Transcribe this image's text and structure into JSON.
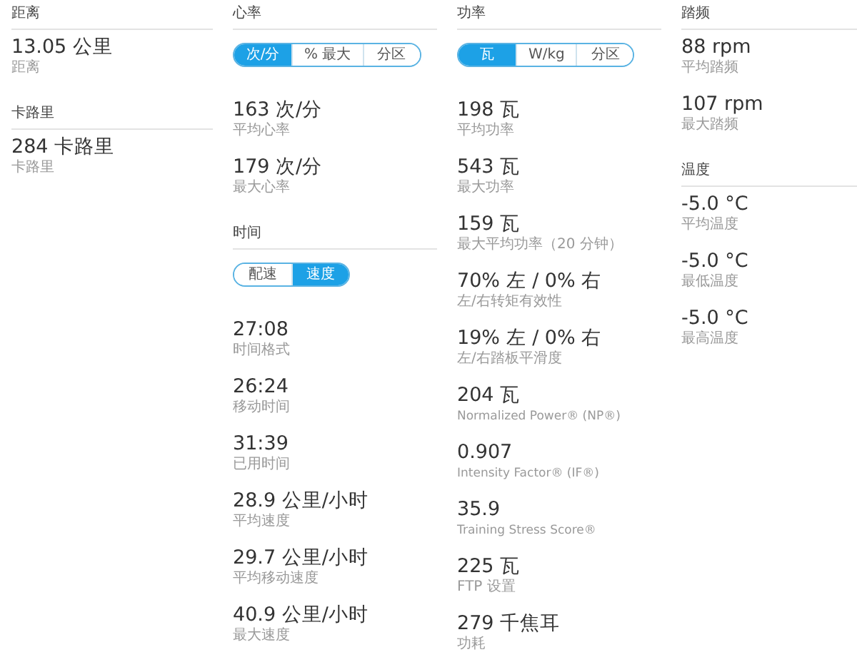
{
  "columns": [
    {
      "sections": [
        {
          "title": "距离",
          "stats": [
            {
              "value": "13.05 公里",
              "label": "距离"
            }
          ]
        },
        {
          "title": "卡路里",
          "stats": [
            {
              "value": "284 卡路里",
              "label": "卡路里"
            }
          ]
        }
      ]
    },
    {
      "sections": [
        {
          "title": "心率",
          "toggle": [
            {
              "label": "次/分",
              "selected": true
            },
            {
              "label": "% 最大",
              "selected": false
            },
            {
              "label": "分区",
              "selected": false
            }
          ],
          "stats": [
            {
              "value": "163 次/分",
              "label": "平均心率"
            },
            {
              "value": "179 次/分",
              "label": "最大心率"
            }
          ]
        },
        {
          "title": "时间",
          "toggle": [
            {
              "label": "配速",
              "selected": false
            },
            {
              "label": "速度",
              "selected": true
            }
          ],
          "stats": [
            {
              "value": "27:08",
              "label": "时间格式"
            },
            {
              "value": "26:24",
              "label": "移动时间"
            },
            {
              "value": "31:39",
              "label": "已用时间"
            },
            {
              "value": "28.9 公里/小时",
              "label": "平均速度"
            },
            {
              "value": "29.7 公里/小时",
              "label": "平均移动速度"
            },
            {
              "value": "40.9 公里/小时",
              "label": "最大速度"
            }
          ]
        }
      ]
    },
    {
      "sections": [
        {
          "title": "功率",
          "toggle": [
            {
              "label": "瓦",
              "selected": true
            },
            {
              "label": "W/kg",
              "selected": false
            },
            {
              "label": "分区",
              "selected": false
            }
          ],
          "stats": [
            {
              "value": "198 瓦",
              "label": "平均功率"
            },
            {
              "value": "543 瓦",
              "label": "最大功率"
            },
            {
              "value": "159 瓦",
              "label": "最大平均功率（20 分钟）"
            },
            {
              "value": "70% 左 / 0% 右",
              "label": "左/右转矩有效性"
            },
            {
              "value": "19% 左 / 0% 右",
              "label": "左/右踏板平滑度"
            },
            {
              "value": "204 瓦",
              "label": "Normalized Power® (NP®)"
            },
            {
              "value": "0.907",
              "label": "Intensity Factor® (IF®)"
            },
            {
              "value": "35.9",
              "label": "Training Stress Score®"
            },
            {
              "value": "225 瓦",
              "label": "FTP 设置"
            },
            {
              "value": "279 千焦耳",
              "label": "功耗"
            }
          ]
        }
      ]
    },
    {
      "sections": [
        {
          "title": "踏频",
          "stats": [
            {
              "value": "88 rpm",
              "label": "平均踏频"
            },
            {
              "value": "107 rpm",
              "label": "最大踏频"
            }
          ]
        },
        {
          "title": "温度",
          "stats": [
            {
              "value": "-5.0 °C",
              "label": "平均温度"
            },
            {
              "value": "-5.0 °C",
              "label": "最低温度"
            },
            {
              "value": "-5.0 °C",
              "label": "最高温度"
            }
          ]
        }
      ]
    }
  ]
}
